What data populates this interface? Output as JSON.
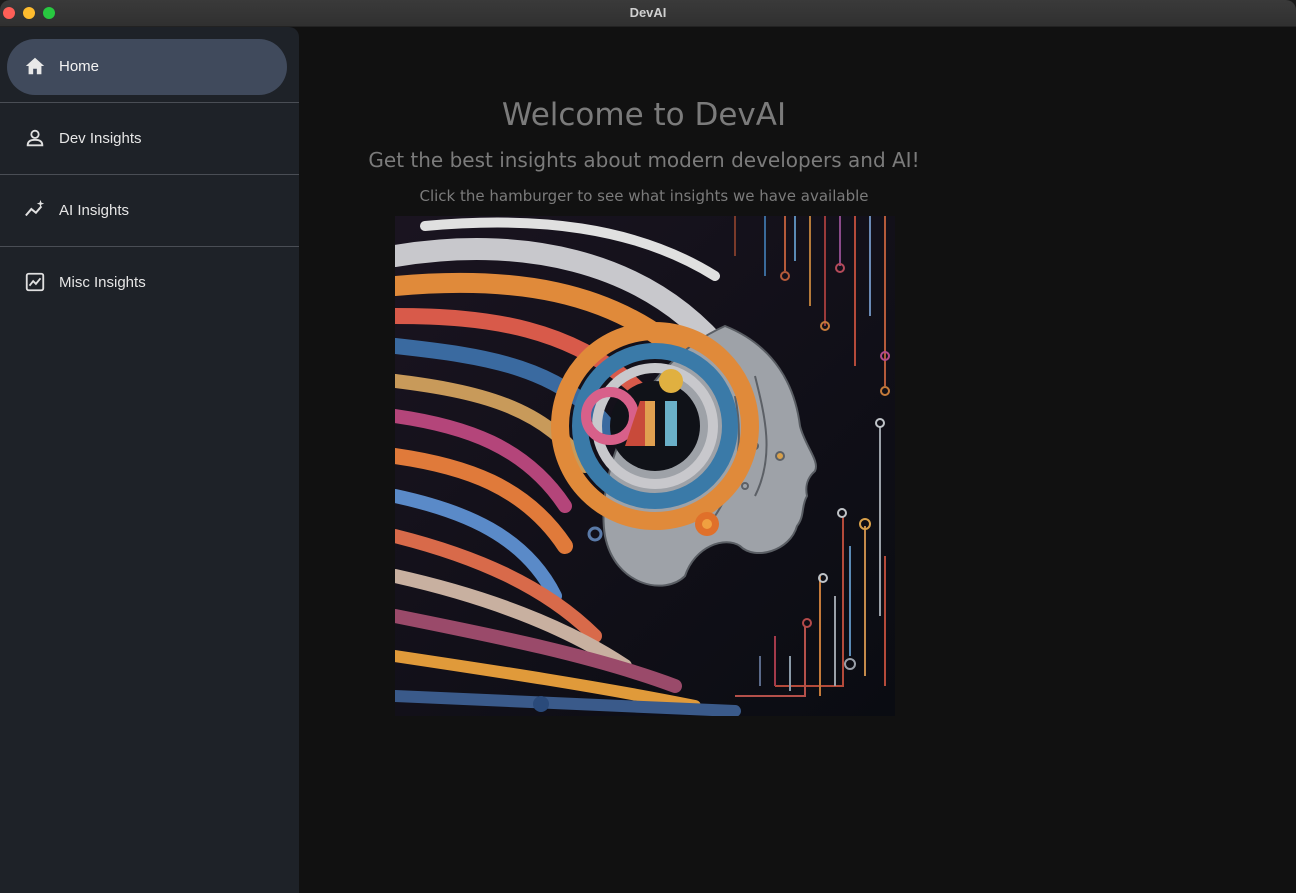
{
  "window": {
    "title": "DevAI"
  },
  "sidebar": {
    "items": [
      {
        "label": "Home",
        "icon": "home-icon",
        "active": true
      },
      {
        "label": "Dev Insights",
        "icon": "person-icon",
        "active": false
      },
      {
        "label": "AI Insights",
        "icon": "sparkle-chart-icon",
        "active": false
      },
      {
        "label": "Misc Insights",
        "icon": "chart-box-icon",
        "active": false
      }
    ]
  },
  "main": {
    "heading": "Welcome to DevAI",
    "subtitle": "Get the best insights about modern developers and AI!",
    "hint": "Click the hamburger to see what insights we have available",
    "hero_image": {
      "description_icon": "ai-face-artwork",
      "logo_text": "AI"
    }
  },
  "colors": {
    "sidebar_bg": "#1e2228",
    "active_pill": "#404a5c",
    "main_bg": "#111111",
    "muted_text": "#7b7b7b"
  }
}
